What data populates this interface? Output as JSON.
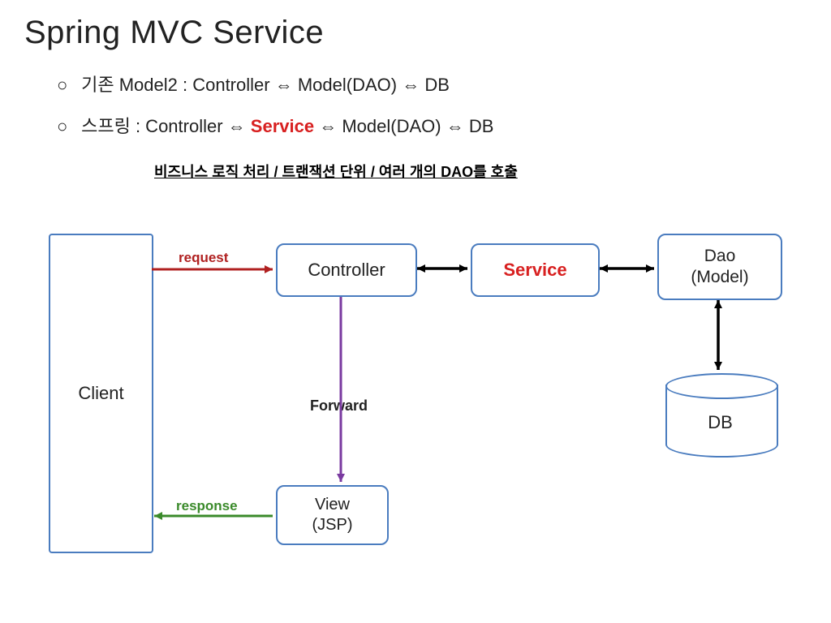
{
  "title": "Spring MVC Service",
  "bullets": {
    "b1_prefix": "기존 Model2 : Controller ",
    "b1_suffix": " Model(DAO) ",
    "b1_tail": " DB",
    "b2_prefix": "스프링 : Controller ",
    "b2_service": "Service",
    "b2_mid": " Model(DAO) ",
    "b2_tail": " DB",
    "arrow": "⇔",
    "marker": "○"
  },
  "subnote": "비즈니스 로직 처리 / 트랜잭션 단위 / 여러 개의 DAO를 호출",
  "nodes": {
    "client": "Client",
    "controller": "Controller",
    "service": "Service",
    "dao": "Dao\n(Model)",
    "view": "View\n(JSP)",
    "db": "DB"
  },
  "labels": {
    "request": "request",
    "response": "response",
    "forward": "Forward"
  },
  "colors": {
    "box_border": "#4a7cbf",
    "service_red": "#d82020",
    "request": "#b02020",
    "response": "#3a8a2a",
    "forward": "#7a3aa0",
    "black_arrow": "#000"
  }
}
